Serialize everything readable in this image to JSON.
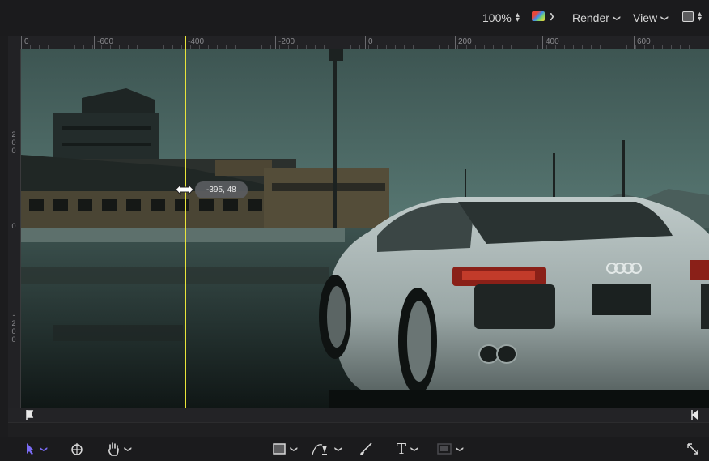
{
  "header": {
    "zoom": "100%",
    "render_label": "Render",
    "view_label": "View",
    "icons": [
      "color-channels-icon",
      "background-square-icon"
    ]
  },
  "ruler": {
    "h_labels": [
      "0",
      "-600",
      "-400",
      "-200",
      "0",
      "200",
      "400",
      "600"
    ],
    "v_labels": [
      {
        "chars": [
          "2",
          "0",
          "0"
        ]
      },
      {
        "chars": [
          "0"
        ]
      },
      {
        "chars": [
          "-",
          "2",
          "0",
          "0"
        ]
      }
    ]
  },
  "canvas": {
    "guide_tooltip": "-395, 48",
    "guide_color": "#e9e43a"
  },
  "timing": {
    "in_marker_icon": "in-point-marker-icon",
    "out_marker_icon": "out-point-marker-icon"
  },
  "toolbar": {
    "tools": [
      {
        "name": "select-tool",
        "icon": "arrow-pointer-icon",
        "color": "#7b6cf6"
      },
      {
        "name": "anchor-tool",
        "icon": "anchor-point-icon"
      },
      {
        "name": "pan-tool",
        "icon": "hand-icon"
      },
      {
        "name": "shape-tool",
        "icon": "rectangle-icon"
      },
      {
        "name": "bezier-tool",
        "icon": "pen-icon"
      },
      {
        "name": "paint-tool",
        "icon": "paintbrush-icon"
      },
      {
        "name": "text-tool",
        "icon": "text-icon"
      },
      {
        "name": "mask-tool",
        "icon": "mask-icon"
      },
      {
        "name": "expand-tool",
        "icon": "expand-arrows-icon"
      }
    ],
    "text_glyph": "T"
  }
}
